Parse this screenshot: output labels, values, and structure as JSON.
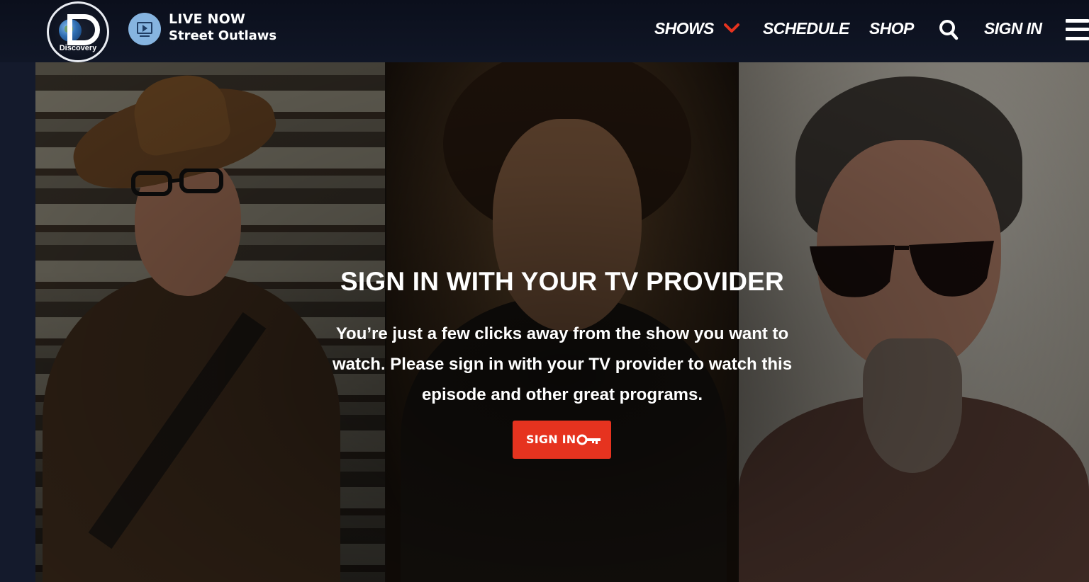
{
  "header": {
    "logo_text": "Discovery",
    "live": {
      "label": "LIVE NOW",
      "show": "Street Outlaws"
    },
    "nav": {
      "shows": "SHOWS",
      "schedule": "SCHEDULE",
      "shop": "SHOP",
      "sign_in": "SIGN IN"
    }
  },
  "hero": {
    "title": "SIGN IN WITH YOUR TV PROVIDER",
    "description": "You’re just a few clicks away from the show you want to watch. Please sign in with your TV provider to watch this episode and other great programs.",
    "button_label": "SIGN IN"
  },
  "colors": {
    "header_bg": "#0b0f1c",
    "accent": "#e6331f",
    "live_icon": "#86b4e0"
  },
  "icons": [
    "tv-play-icon",
    "chevron-down-icon",
    "search-icon",
    "menu-icon",
    "key-icon"
  ]
}
